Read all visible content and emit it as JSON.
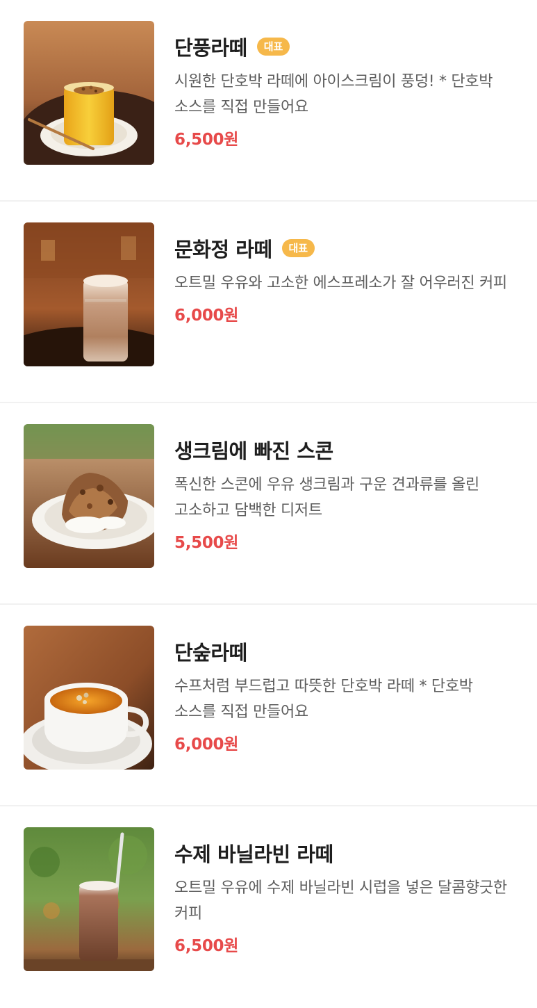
{
  "menu": {
    "items": [
      {
        "name": "단풍라떼",
        "badge": "대표",
        "description": "시원한 단호박 라떼에 아이스크림이 풍덩! * 단호박 소스를 직접 만들어요",
        "price": "6,500원",
        "image": "pumpkin-latte-photo"
      },
      {
        "name": "문화정 라떼",
        "badge": "대표",
        "description": "오트밀 우유와 고소한 에스프레소가 잘 어우러진 커피",
        "price": "6,000원",
        "image": "oat-latte-photo"
      },
      {
        "name": "생크림에 빠진 스콘",
        "description": "폭신한 스콘에 우유 생크림과 구운 견과류를 올린 고소하고 담백한 디저트",
        "price": "5,500원",
        "image": "scone-photo"
      },
      {
        "name": "단숲라떼",
        "description": "수프처럼 부드럽고 따뜻한 단호박 라떼 * 단호박 소스를 직접 만들어요",
        "price": "6,000원",
        "image": "hot-pumpkin-latte-photo"
      },
      {
        "name": "수제 바닐라빈 라떼",
        "description": "오트밀 우유에 수제 바닐라빈 시럽을 넣은 달콤향긋한 커피",
        "price": "6,500원",
        "image": "vanilla-latte-photo"
      }
    ]
  },
  "colors": {
    "price": "#e74a4a",
    "badge": "#f6b84a",
    "divider": "#f1f1f1"
  }
}
